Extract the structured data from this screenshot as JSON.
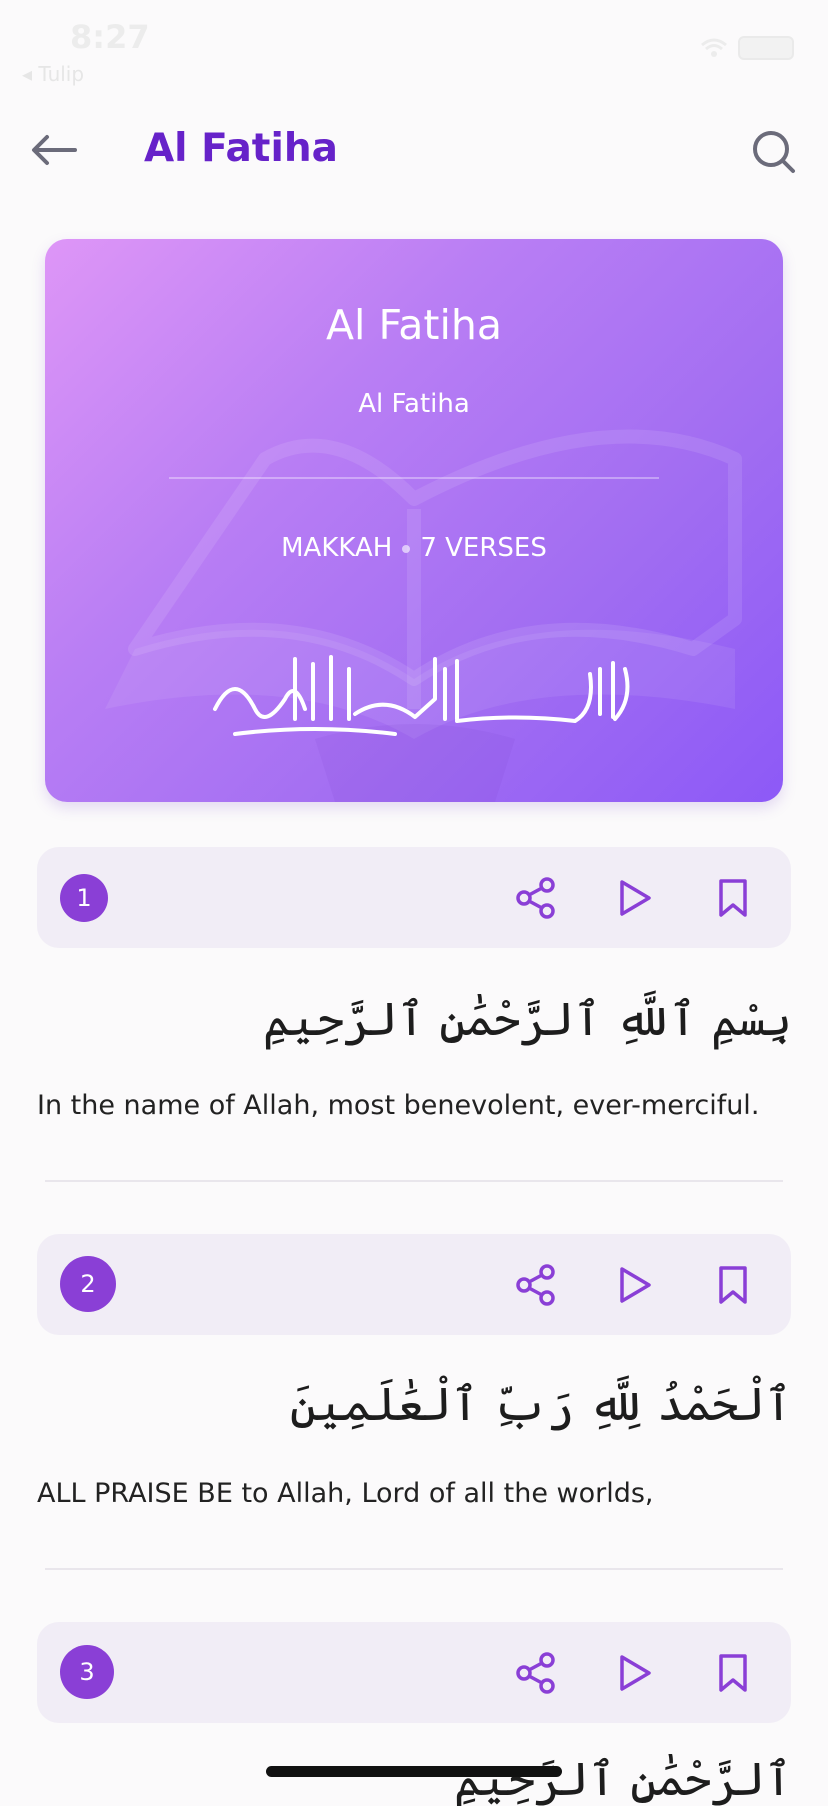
{
  "status_bar": {
    "time": "8:27",
    "back_app": "◂ Tulip"
  },
  "header": {
    "title": "Al Fatiha"
  },
  "hero": {
    "title": "Al Fatiha",
    "subtitle": "Al Fatiha",
    "place": "MAKKAH",
    "verses": "7 VERSES"
  },
  "verses": [
    {
      "number": "1",
      "arabic": "بِسْمِ ٱللَّهِ ٱلرَّحْمَٰنِ ٱلرَّحِيمِ",
      "translation": "In the name of Allah, most benevolent, ever-merciful."
    },
    {
      "number": "2",
      "arabic": "ٱلْحَمْدُ لِلَّهِ رَبِّ ٱلْعَٰلَمِينَ",
      "translation": "ALL PRAISE BE to Allah, Lord of all the worlds,"
    },
    {
      "number": "3",
      "arabic": "ٱلرَّحْمَٰنِ ٱلرَّحِيمِ",
      "translation": ""
    }
  ],
  "icons": {
    "back": "arrow-left-icon",
    "search": "search-icon",
    "share": "share-icon",
    "play": "play-icon",
    "bookmark": "bookmark-icon"
  },
  "colors": {
    "accent": "#6622c9",
    "verse_badge": "#8a3fd6",
    "verse_bar": "#f1edf6",
    "hero_gradient_start": "#de96f7",
    "hero_gradient_end": "#8d59f7"
  }
}
